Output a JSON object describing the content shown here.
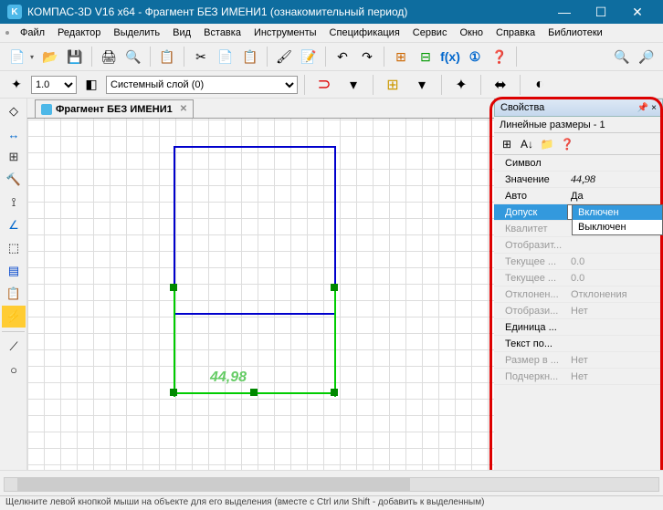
{
  "title": "КОМПАС-3D V16  x64 - Фрагмент БЕЗ ИМЕНИ1 (ознакомительный период)",
  "menu": [
    "Файл",
    "Редактор",
    "Выделить",
    "Вид",
    "Вставка",
    "Инструменты",
    "Спецификация",
    "Сервис",
    "Окно",
    "Справка",
    "Библиотеки"
  ],
  "scale": "1.0",
  "layer": "Системный слой (0)",
  "tab": "Фрагмент БЕЗ ИМЕНИ1",
  "dim_value": "44,98",
  "props": {
    "title": "Свойства",
    "subtitle": "Линейные размеры - 1",
    "rows": [
      {
        "k": "Символ",
        "v": ""
      },
      {
        "k": "Значение",
        "v": "44,98",
        "italic": true
      },
      {
        "k": "Авто",
        "v": "Да"
      },
      {
        "k": "Допуск",
        "v": "Выключен",
        "sel": true
      },
      {
        "k": "Квалитет",
        "v": "",
        "dim": true
      },
      {
        "k": "Отобразит...",
        "v": "",
        "dim": true
      },
      {
        "k": "Текущее ...",
        "v": "0.0",
        "dim": true
      },
      {
        "k": "Текущее ...",
        "v": "0.0",
        "dim": true
      },
      {
        "k": "Отклонен...",
        "v": "Отклонения",
        "dim": true
      },
      {
        "k": "Отобрази...",
        "v": "Нет",
        "dim": true
      },
      {
        "k": "Единица ...",
        "v": ""
      },
      {
        "k": "Текст по...",
        "v": ""
      },
      {
        "k": "Размер в ...",
        "v": "Нет",
        "dim": true
      },
      {
        "k": "Подчеркн...",
        "v": "Нет",
        "dim": true
      }
    ],
    "dropdown": [
      "Включен",
      "Выключен"
    ]
  },
  "status": "Щелкните левой кнопкой мыши на объекте для его выделения (вместе с Ctrl или Shift - добавить к выделенным)"
}
